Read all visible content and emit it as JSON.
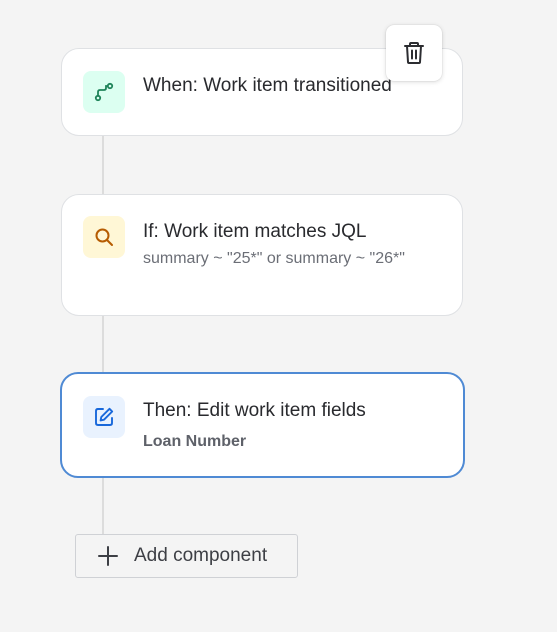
{
  "rule": {
    "trigger": {
      "title": "When: Work item transitioned",
      "icon": "branch-icon",
      "icon_bg": "#dcfff1",
      "icon_color": "#1f845a"
    },
    "condition": {
      "title": "If: Work item matches JQL",
      "detail": "summary ~ \"25*\" or summary ~ \"26*\"",
      "icon": "search-icon",
      "icon_bg": "#fff7d6",
      "icon_color": "#b65c02"
    },
    "action": {
      "title": "Then: Edit work item fields",
      "detail": "Loan Number",
      "icon": "edit-icon",
      "icon_bg": "#e9f2fe",
      "icon_color": "#1868db",
      "selected_border": "#4f8ad4"
    }
  },
  "toolbar": {
    "delete_icon": "trash-icon"
  },
  "add_component": {
    "label": "Add component",
    "icon": "plus-icon"
  }
}
